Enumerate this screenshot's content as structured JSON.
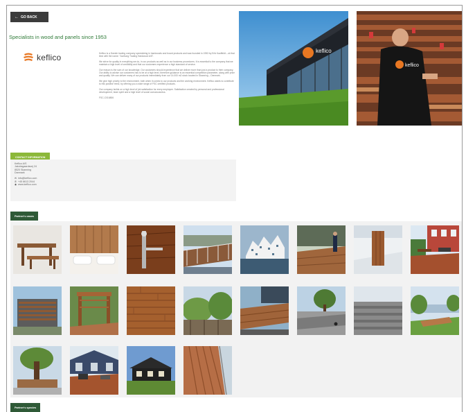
{
  "nav": {
    "back_label": "GO BACK"
  },
  "company": {
    "headline": "Specialists in wood and panels since 1953",
    "logo_text": "keflico",
    "description": [
      "Keflico is a Danish trading company specializing in hardwoods and board products and was founded in 1953 by Erik Kauffeldt – at that time with the name: \"Aarhung Trading Hardwood A/S\".",
      "We strive for quality in everything we do, in our products as well as in our business procedures. It is essential to the company that we maintain a high level of credibility and that our customers experience a high standard of service.",
      "Our reason is the sum of our knowledge. Our customers should experience that we deliver more than just a product to their company. Our ability to advise our customers has to be at a high level, therefore guidance is an essential competition parameter, along with price and quality. We can deliver many of our products immediately from our 14.000 m2 stock located in Skanning – Denmark.",
      "We give high priority to the environment, both when it comes to our products and the working environment. Keflico wants to contribute to this positive trend, by offering you a wide range of FSC certified products.",
      "Our company builds on a high level of job satisfaction for every employee. Satisfaction created by personal and professional development, team spirit and a high level of social consciousness.",
      "FSC-C016806"
    ]
  },
  "contact": {
    "heading": "CONTACT INFORMATION",
    "name": "Keflico A/S",
    "street": "Jakobsgaardsvej 24",
    "city": "8520 Skanning",
    "country": "Danmark",
    "email": "info@keflico.com",
    "phone": "+45 8613 2044",
    "web": "www.keflico.com"
  },
  "sections": {
    "partners_cases": "Partner's cases",
    "partners_species": "Partner's species"
  },
  "icons": {
    "back": "arrow-left-icon",
    "email": "envelope-icon",
    "phone": "phone-icon",
    "web": "globe-icon"
  },
  "colors": {
    "accent_green": "#8cb83a",
    "dark_green": "#2f5a37",
    "headline_green": "#2e7a37",
    "logo_orange": "#e87722",
    "back_button": "#3b3b3b"
  },
  "gallery": [
    {
      "subject": "picnic-table"
    },
    {
      "subject": "wooden-headboard"
    },
    {
      "subject": "door-handle"
    },
    {
      "subject": "wooden-bridge"
    },
    {
      "subject": "white-buildings"
    },
    {
      "subject": "deck-worker"
    },
    {
      "subject": "snowy-post"
    },
    {
      "subject": "house-terrace"
    },
    {
      "subject": "slatted-shed"
    },
    {
      "subject": "pergola"
    },
    {
      "subject": "decking-closeup"
    },
    {
      "subject": "garden-fence"
    },
    {
      "subject": "urban-platform"
    },
    {
      "subject": "plaza-trees"
    },
    {
      "subject": "wooden-steps"
    },
    {
      "subject": "lakeside-deck"
    },
    {
      "subject": "tree-bench"
    },
    {
      "subject": "house-deck"
    },
    {
      "subject": "cottage"
    },
    {
      "subject": "railing-deck"
    }
  ]
}
